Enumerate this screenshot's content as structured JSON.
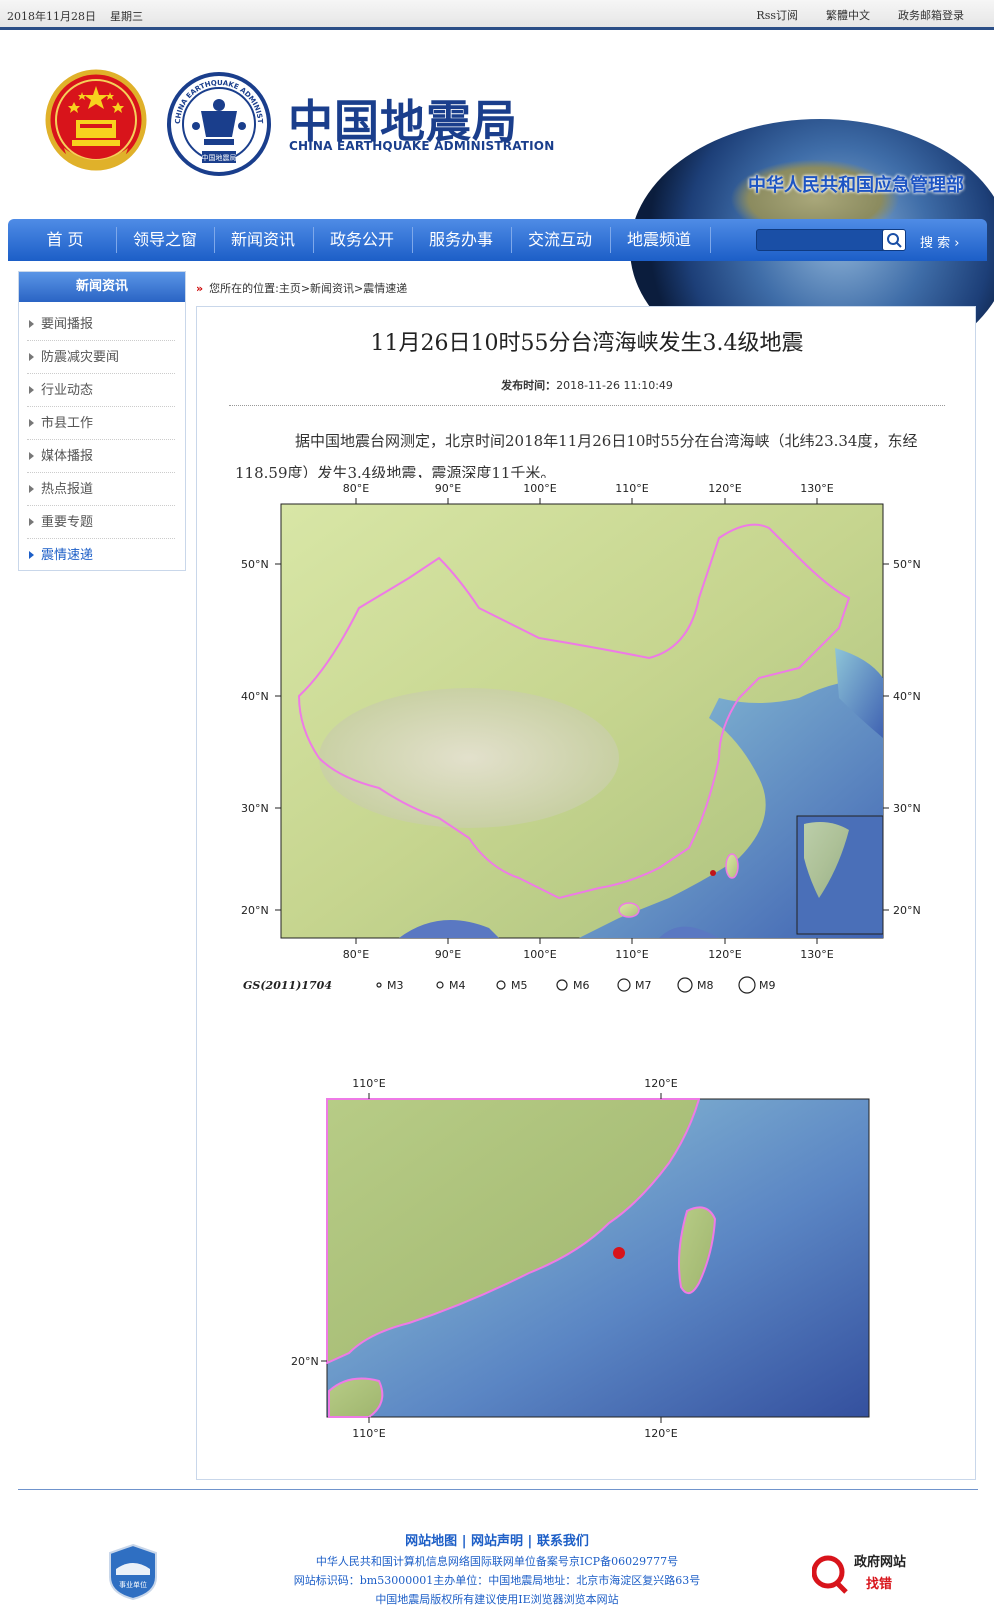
{
  "topbar": {
    "date": "2018年11月28日",
    "weekday": "星期三",
    "links": [
      "Rss订阅",
      "繁體中文",
      "政务邮箱登录"
    ]
  },
  "header": {
    "title_cn": "中国地震局",
    "title_en": "CHINA EARTHQUAKE ADMINISTRATION",
    "ministry": "中华人民共和国应急管理部",
    "seal_text": "CHINA EARTHQUAKE ADMINISTRATION",
    "seal_text_cn": "中国地震局"
  },
  "nav": {
    "items": [
      "首 页",
      "领导之窗",
      "新闻资讯",
      "政务公开",
      "服务办事",
      "交流互动",
      "地震频道"
    ],
    "search_placeholder": "",
    "search_label": "搜 索 ›"
  },
  "sidebar": {
    "heading": "新闻资讯",
    "items": [
      "要闻播报",
      "防震减灾要闻",
      "行业动态",
      "市县工作",
      "媒体播报",
      "热点报道",
      "重要专题",
      "震情速递"
    ],
    "active_index": 7
  },
  "breadcrumb": {
    "mark": "»",
    "text": "您所在的位置:主页>新闻资讯>震情速递"
  },
  "article": {
    "title": "11月26日10时55分台湾海峡发生3.4级地震",
    "pubtime_label": "发布时间：",
    "pubtime": "2018-11-26 11:10:49",
    "body": "据中国地震台网测定，北京时间2018年11月26日10时55分在台湾海峡（北纬23.34度，东经118.59度）发生3.4级地震，震源深度11千米。"
  },
  "map1": {
    "lon_labels": [
      "80°E",
      "90°E",
      "100°E",
      "110°E",
      "120°E",
      "130°E"
    ],
    "lat_labels": [
      "50°N",
      "40°N",
      "30°N",
      "20°N"
    ],
    "credit": "GS(2011)1704",
    "legend": [
      "M3",
      "M4",
      "M5",
      "M6",
      "M7",
      "M8",
      "M9"
    ]
  },
  "map2": {
    "lon_labels": [
      "110°E",
      "120°E"
    ],
    "lat_labels": [
      "20°N"
    ]
  },
  "footer": {
    "links": [
      "网站地图",
      "网站声明",
      "联系我们"
    ],
    "line1": "中华人民共和国计算机信息网络国际联网单位备案号京ICP备06029777号",
    "line2": "网站标识码：bm53000001主办单位：中国地震局地址：北京市海淀区复兴路63号",
    "line3": "中国地震局版权所有建议使用IE浏览器浏览本网站",
    "badge_left": "事业单位",
    "badge_right_top": "政府网站",
    "badge_right_bottom": "找错"
  },
  "colors": {
    "nav_blue": "#1c5ec7",
    "header_blue": "#1a3e8c",
    "quake_dot": "#d8141b",
    "border_pink": "#ee7ae6"
  }
}
